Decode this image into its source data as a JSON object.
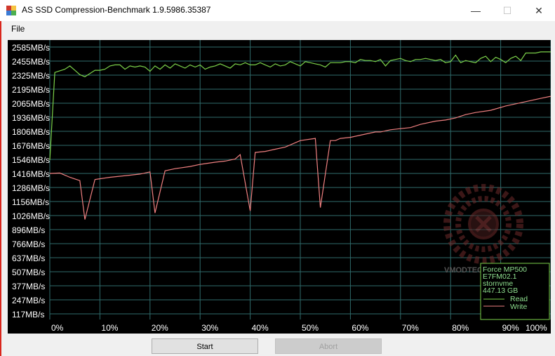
{
  "window": {
    "title": "AS SSD Compression-Benchmark 1.9.5986.35387",
    "minimize_glyph": "—",
    "maximize_glyph": "☐",
    "close_glyph": "✕"
  },
  "menu": {
    "file_label": "File"
  },
  "buttons": {
    "start_label": "Start",
    "abort_label": "Abort"
  },
  "watermark": {
    "text": "VMODTECH.COM"
  },
  "legend": {
    "device": "Force MP500",
    "firmware": "E7FM02.1",
    "driver": "stornvme",
    "capacity": "447.13 GB",
    "read_label": "Read",
    "write_label": "Write"
  },
  "colors": {
    "read": "#7cd24a",
    "write": "#f08080",
    "grid": "#2f6b6b",
    "axis_text": "#ffffff",
    "legend_text": "#8fe08f"
  },
  "chart_data": {
    "type": "line",
    "y_ticks": [
      "2585MB/s",
      "2455MB/s",
      "2325MB/s",
      "2195MB/s",
      "2065MB/s",
      "1936MB/s",
      "1806MB/s",
      "1676MB/s",
      "1546MB/s",
      "1416MB/s",
      "1286MB/s",
      "1156MB/s",
      "1026MB/s",
      "896MB/s",
      "766MB/s",
      "637MB/s",
      "507MB/s",
      "377MB/s",
      "247MB/s",
      "117MB/s"
    ],
    "x_ticks": [
      "0%",
      "10%",
      "20%",
      "30%",
      "40%",
      "50%",
      "60%",
      "70%",
      "80%",
      "90%",
      "100%"
    ],
    "ylim": [
      117,
      2585
    ],
    "xlim": [
      0,
      100
    ],
    "grid": true,
    "series": [
      {
        "name": "Read",
        "x": [
          0,
          1,
          3,
          4,
          5,
          6,
          7,
          8,
          9,
          10,
          11,
          12,
          13,
          14,
          15,
          16,
          17,
          18,
          19,
          20,
          21,
          22,
          23,
          24,
          25,
          26,
          27,
          28,
          29,
          30,
          31,
          32,
          33,
          34,
          35,
          36,
          37,
          38,
          39,
          40,
          41,
          42,
          43,
          44,
          45,
          46,
          47,
          48,
          49,
          50,
          51,
          52,
          53,
          54,
          55,
          56,
          57,
          58,
          59,
          60,
          61,
          62,
          63,
          64,
          65,
          66,
          67,
          68,
          69,
          70,
          71,
          72,
          73,
          74,
          75,
          76,
          77,
          78,
          79,
          80,
          81,
          82,
          83,
          84,
          85,
          86,
          87,
          88,
          89,
          90,
          91,
          92,
          93,
          94,
          95,
          96,
          97,
          98,
          99,
          100
        ],
        "values": [
          1540,
          2350,
          2380,
          2410,
          2370,
          2330,
          2310,
          2340,
          2370,
          2370,
          2380,
          2410,
          2420,
          2420,
          2380,
          2410,
          2400,
          2410,
          2400,
          2360,
          2410,
          2380,
          2420,
          2390,
          2430,
          2410,
          2390,
          2420,
          2400,
          2420,
          2380,
          2400,
          2410,
          2430,
          2410,
          2390,
          2430,
          2420,
          2440,
          2420,
          2420,
          2440,
          2420,
          2400,
          2430,
          2410,
          2420,
          2450,
          2430,
          2410,
          2450,
          2440,
          2430,
          2420,
          2400,
          2440,
          2440,
          2440,
          2450,
          2450,
          2440,
          2470,
          2460,
          2460,
          2450,
          2470,
          2410,
          2460,
          2470,
          2480,
          2460,
          2450,
          2470,
          2470,
          2480,
          2470,
          2460,
          2470,
          2440,
          2450,
          2510,
          2440,
          2460,
          2450,
          2440,
          2480,
          2500,
          2450,
          2490,
          2470,
          2440,
          2480,
          2500,
          2460,
          2530,
          2530,
          2530,
          2540,
          2540,
          2540
        ],
        "color": "#7cd24a"
      },
      {
        "name": "Write",
        "x": [
          0,
          2,
          4,
          6,
          7,
          9,
          12,
          16,
          18,
          20,
          21,
          23,
          25,
          28,
          30,
          33,
          35,
          37,
          38,
          40,
          41,
          43,
          45,
          47,
          50,
          53,
          54,
          56,
          57,
          58,
          60,
          62,
          65,
          66,
          68,
          70,
          72,
          74,
          77,
          79,
          81,
          83,
          85,
          88,
          91,
          94,
          96,
          98,
          100
        ],
        "values": [
          1416,
          1420,
          1380,
          1350,
          990,
          1360,
          1380,
          1400,
          1410,
          1430,
          1050,
          1440,
          1460,
          1480,
          1500,
          1520,
          1530,
          1550,
          1590,
          1070,
          1610,
          1620,
          1640,
          1660,
          1720,
          1740,
          1100,
          1720,
          1720,
          1740,
          1750,
          1770,
          1800,
          1800,
          1820,
          1830,
          1840,
          1870,
          1900,
          1910,
          1930,
          1960,
          1980,
          2000,
          2040,
          2070,
          2090,
          2110,
          2130
        ],
        "color": "#f08080"
      }
    ]
  }
}
